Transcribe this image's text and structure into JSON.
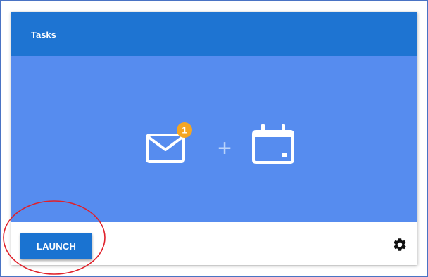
{
  "card": {
    "title": "Tasks",
    "badge_count": "1",
    "plus_symbol": "+",
    "launch_label": "LAUNCH"
  },
  "icons": {
    "mail": "mail-icon",
    "calendar": "calendar-icon",
    "settings": "gear-icon"
  },
  "colors": {
    "header": "#1e74d2",
    "hero": "#568cef",
    "button": "#1a73d1",
    "badge": "#f5a623",
    "annotation": "#e0202a"
  }
}
